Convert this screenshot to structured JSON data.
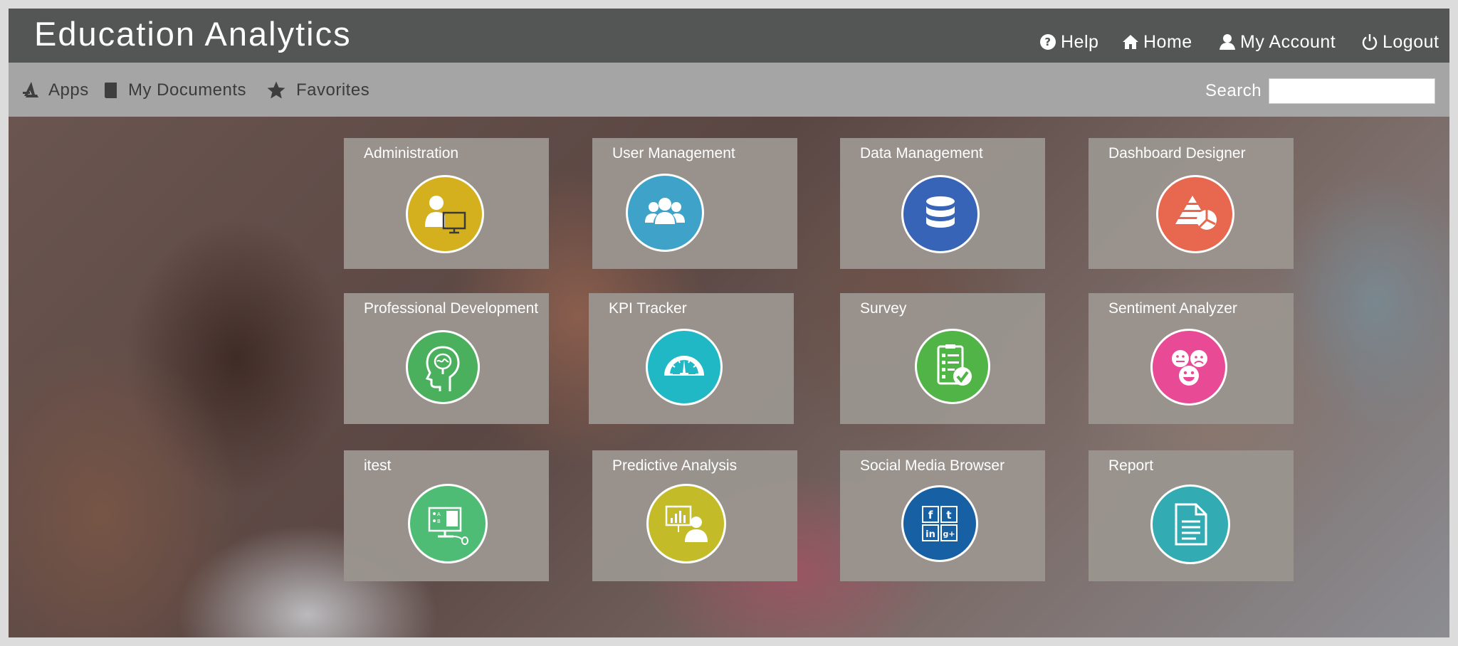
{
  "header": {
    "title": "Education Analytics",
    "links": {
      "help": "Help",
      "home": "Home",
      "account": "My Account",
      "logout": "Logout"
    }
  },
  "subnav": {
    "apps": "Apps",
    "documents": "My Documents",
    "favorites": "Favorites",
    "search_label": "Search",
    "search_value": ""
  },
  "tiles": [
    {
      "label": "Administration",
      "icon": "admin-user-monitor-icon",
      "color": "#d4b01f"
    },
    {
      "label": "User Management",
      "icon": "users-group-icon",
      "color": "#3fa3c9"
    },
    {
      "label": "Data Management",
      "icon": "database-icon",
      "color": "#3764b7"
    },
    {
      "label": "Dashboard Designer",
      "icon": "pyramid-chart-icon",
      "color": "#e8674f"
    },
    {
      "label": "Professional Development",
      "icon": "head-brain-icon",
      "color": "#4ab05e"
    },
    {
      "label": "KPI Tracker",
      "icon": "gauge-icon",
      "color": "#21b8c6"
    },
    {
      "label": "Survey",
      "icon": "checklist-icon",
      "color": "#51b447"
    },
    {
      "label": "Sentiment Analyzer",
      "icon": "emoji-faces-icon",
      "color": "#e84a96"
    },
    {
      "label": "itest",
      "icon": "computer-quiz-icon",
      "color": "#4fbc76"
    },
    {
      "label": "Predictive Analysis",
      "icon": "presenter-chart-icon",
      "color": "#c4bb29"
    },
    {
      "label": "Social Media Browser",
      "icon": "social-grid-icon",
      "color": "#1760a3"
    },
    {
      "label": "Report",
      "icon": "document-icon",
      "color": "#32abb2"
    }
  ]
}
